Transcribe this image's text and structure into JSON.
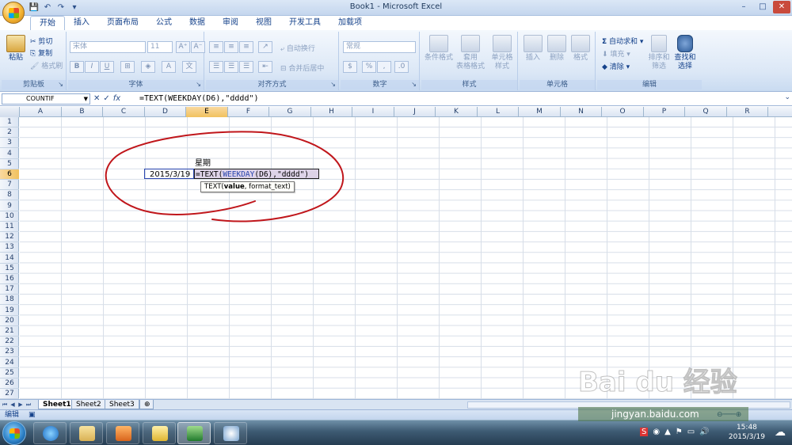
{
  "window": {
    "title": "Book1 - Microsoft Excel",
    "controls": [
      "minimize",
      "maximize",
      "close"
    ]
  },
  "ribbon": {
    "tabs": [
      {
        "label": "开始",
        "active": true
      },
      {
        "label": "插入"
      },
      {
        "label": "页面布局"
      },
      {
        "label": "公式"
      },
      {
        "label": "数据"
      },
      {
        "label": "审阅"
      },
      {
        "label": "视图"
      },
      {
        "label": "开发工具"
      },
      {
        "label": "加载项"
      }
    ],
    "clipboard": {
      "paste": "粘贴",
      "cut": "剪切",
      "copy": "复制",
      "format_painter": "格式刷",
      "group": "剪贴板"
    },
    "font": {
      "name": "宋体",
      "size": "11",
      "bold": "B",
      "italic": "I",
      "underline": "U",
      "group": "字体"
    },
    "alignment": {
      "wrap": "自动换行",
      "merge": "合并后居中",
      "group": "对齐方式"
    },
    "number": {
      "format": "常规",
      "percent": "%",
      "comma": ",",
      "group": "数字"
    },
    "styles": {
      "conditional": "条件格式",
      "table1": "套用",
      "table2": "表格格式",
      "cell1": "单元格",
      "cell2": "样式",
      "group": "样式"
    },
    "cells": {
      "insert": "插入",
      "delete": "删除",
      "format": "格式",
      "group": "单元格"
    },
    "editing": {
      "autosum": "自动求和",
      "fill": "填充",
      "clear": "清除",
      "sort1": "排序和",
      "sort2": "筛选",
      "find1": "查找和",
      "find2": "选择",
      "group": "编辑"
    }
  },
  "formula_bar": {
    "name_box": "COUNTIF",
    "formula": "=TEXT(WEEKDAY(D6),\"dddd\")"
  },
  "columns": [
    "A",
    "B",
    "C",
    "D",
    "E",
    "F",
    "G",
    "H",
    "I",
    "J",
    "K",
    "L",
    "M",
    "N",
    "O",
    "P",
    "Q",
    "R"
  ],
  "selected_column": "E",
  "rows": [
    "1",
    "2",
    "3",
    "4",
    "5",
    "6",
    "7",
    "8",
    "9",
    "10",
    "11",
    "12",
    "13",
    "14",
    "15",
    "16",
    "17",
    "18",
    "19",
    "20",
    "21",
    "22",
    "23",
    "24",
    "25",
    "26",
    "27"
  ],
  "selected_row": "6",
  "cells": {
    "E5": "星期",
    "D6": "2015/3/19",
    "E6_fn_text": "=TEXT(",
    "E6_fn_weekday": "WEEKDAY",
    "E6_arg": "(D6),",
    "E6_fmt": "\"dddd\")"
  },
  "tooltip": {
    "fn": "TEXT(",
    "arg1": "value",
    "rest": ", format_text)"
  },
  "sheets": [
    {
      "label": "Sheet1",
      "active": true
    },
    {
      "label": "Sheet2"
    },
    {
      "label": "Sheet3"
    }
  ],
  "status": {
    "mode": "编辑"
  },
  "taskbar": {
    "time": "15:48",
    "date": "2015/3/19"
  },
  "watermark": {
    "logo": "Bai du 经验",
    "url": "jingyan.baidu.com"
  },
  "colors": {
    "accent": "#15428b",
    "annotation": "#c0161b",
    "selection": "#f1c15f"
  }
}
